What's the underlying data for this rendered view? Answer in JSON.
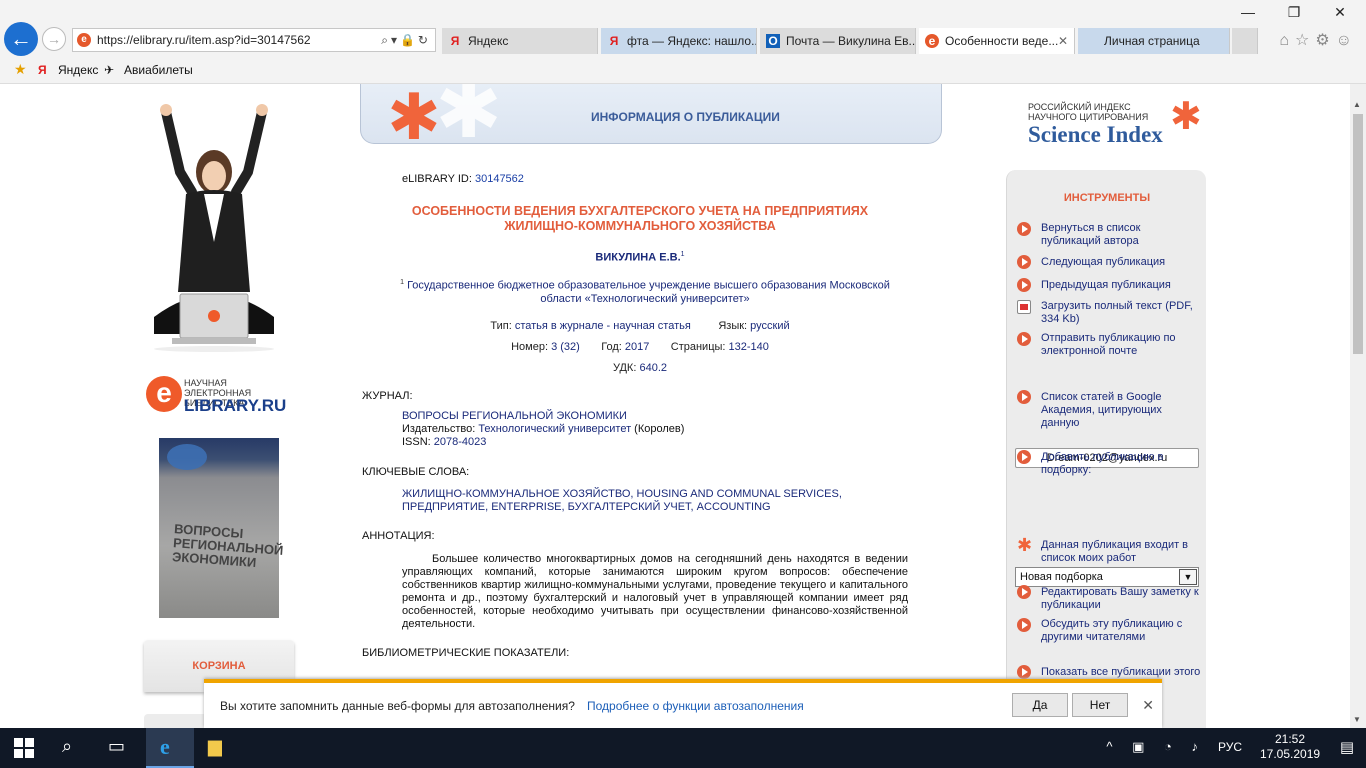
{
  "browser": {
    "url": "https://elibrary.ru/item.asp?id=30147562",
    "tabs": [
      {
        "label": "Яндекс",
        "icon": "Я"
      },
      {
        "label": "фта — Яндекс: нашло...",
        "icon": "Я"
      },
      {
        "label": "Почта — Викулина Ев...",
        "icon": "O"
      },
      {
        "label": "Особенности веде...",
        "icon": "e"
      },
      {
        "label": "Личная страница",
        "icon": ""
      }
    ],
    "favorites": [
      "Яндекс",
      "Авиабилеты"
    ]
  },
  "left": {
    "logo_line1": "НАУЧНАЯ ЭЛЕКТРОННАЯ",
    "logo_line2": "БИБЛИОТЕКА",
    "logo_brand": "LIBRARY.RU",
    "logo_e": "e",
    "cover_title": "ВОПРОСЫ РЕГИОНАЛЬНОЙ ЭКОНОМИКИ",
    "cart": "КОРЗИНА"
  },
  "header": {
    "title": "ИНФОРМАЦИЯ О ПУБЛИКАЦИИ"
  },
  "pub": {
    "id_label": "eLIBRARY ID:",
    "id": "30147562",
    "title": "ОСОБЕННОСТИ ВЕДЕНИЯ БУХГАЛТЕРСКОГО УЧЕТА НА ПРЕДПРИЯТИЯХ ЖИЛИЩНО-КОММУНАЛЬНОГО ХОЗЯЙСТВА",
    "author": "ВИКУЛИНА Е.В.",
    "author_sup": "1",
    "affil_sup": "1",
    "affiliation": "Государственное бюджетное образовательное учреждение высшего образования Московской области «Технологический университет»",
    "type_label": "Тип:",
    "type": "статья в журнале - научная статья",
    "lang_label": "Язык:",
    "lang": "русский",
    "num_label": "Номер:",
    "num": "3 (32)",
    "year_label": "Год:",
    "year": "2017",
    "pages_label": "Страницы:",
    "pages": "132-140",
    "udk_label": "УДК:",
    "udk": "640.2"
  },
  "journal": {
    "label": "ЖУРНАЛ:",
    "name": "ВОПРОСЫ РЕГИОНАЛЬНОЙ ЭКОНОМИКИ",
    "publisher_label": "Издательство:",
    "publisher": "Технологический университет",
    "publisher_city": "(Королев)",
    "issn_label": "ISSN:",
    "issn": "2078-4023"
  },
  "keywords": {
    "label": "КЛЮЧЕВЫЕ СЛОВА:",
    "text": "ЖИЛИЩНО-КОММУНАЛЬНОЕ ХОЗЯЙСТВО, HOUSING AND COMMUNAL SERVICES, ПРЕДПРИЯТИЕ, ENTERPRISE, БУХГАЛТЕРСКИЙ УЧЕТ, ACCOUNTING"
  },
  "abstract": {
    "label": "АННОТАЦИЯ:",
    "text": "Большее количество многоквартирных домов на сегодняшний день находятся в ведении управляющих компаний, которые занимаются широким кругом вопросов: обеспечение собственников квартир жилищно-коммунальными услугами, проведение текущего и капитального ремонта и др., поэтому бухгалтерский и налоговый учет в управляющей компании имеет ряд особенностей, которые необходимо учитывать при осуществлении финансово-хозяйственной деятельности."
  },
  "biblio": {
    "label": "БИБЛИОМЕТРИЧЕСКИЕ ПОКАЗАТЕЛИ:"
  },
  "science_index": {
    "line1": "РОССИЙСКИЙ ИНДЕКС",
    "line2": "НАУЧНОГО ЦИТИРОВАНИЯ",
    "brand": "Science Index"
  },
  "tools": {
    "title": "ИНСТРУМЕНТЫ",
    "items": [
      "Вернуться в список публикаций автора",
      "Следующая публикация",
      "Предыдущая публикация",
      "Загрузить полный текст (PDF, 334 Kb)",
      "Отправить публикацию по электронной почте",
      "Список статей в Google Академия, цитирующих данную",
      "Добавить публикацию в подборку:",
      "Данная публикация входит в список моих работ",
      "Редактировать Вашу заметку к публикации",
      "Обсудить эту публикацию с другими читателями",
      "Показать все публикации этого"
    ],
    "email": "Dream-0202@yandex.ru",
    "collection": "Новая подборка"
  },
  "autofill": {
    "question": "Вы хотите запомнить данные веб-формы для автозаполнения?",
    "more": "Подробнее о функции автозаполнения",
    "yes": "Да",
    "no": "Нет"
  },
  "taskbar": {
    "lang": "РУС",
    "time": "21:52",
    "date": "17.05.2019"
  }
}
